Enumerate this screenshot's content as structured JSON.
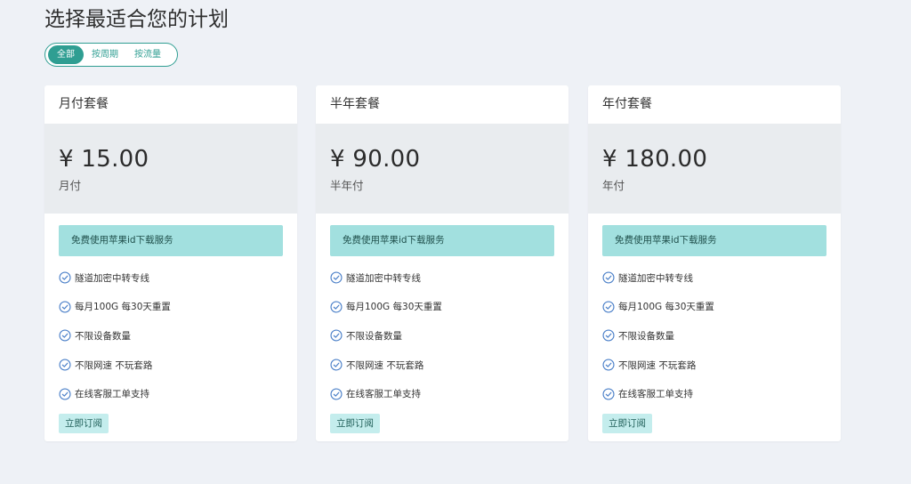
{
  "page": {
    "title": "选择最适合您的计划"
  },
  "filters": [
    {
      "label": "全部",
      "active": true
    },
    {
      "label": "按周期",
      "active": false
    },
    {
      "label": "按流量",
      "active": false
    }
  ],
  "colors": {
    "accent": "#2f9e92",
    "highlight_bg": "#a2e0df",
    "price_bg": "#e9ecef",
    "subscribe_bg": "#c4eded",
    "check_icon": "#4a7fc8"
  },
  "plans": [
    {
      "name": "月付套餐",
      "price": "¥ 15.00",
      "period": "月付",
      "highlight": "免费使用苹果id下载服务",
      "features": [
        "隧道加密中转专线",
        "每月100G 每30天重置",
        "不限设备数量",
        "不限网速 不玩套路",
        "在线客服工单支持"
      ],
      "subscribe_label": "立即订阅"
    },
    {
      "name": "半年套餐",
      "price": "¥ 90.00",
      "period": "半年付",
      "highlight": "免费使用苹果id下载服务",
      "features": [
        "隧道加密中转专线",
        "每月100G 每30天重置",
        "不限设备数量",
        "不限网速 不玩套路",
        "在线客服工单支持"
      ],
      "subscribe_label": "立即订阅"
    },
    {
      "name": "年付套餐",
      "price": "¥ 180.00",
      "period": "年付",
      "highlight": "免费使用苹果id下载服务",
      "features": [
        "隧道加密中转专线",
        "每月100G 每30天重置",
        "不限设备数量",
        "不限网速 不玩套路",
        "在线客服工单支持"
      ],
      "subscribe_label": "立即订阅"
    }
  ],
  "icons": {
    "feature": "check-circle-icon"
  }
}
